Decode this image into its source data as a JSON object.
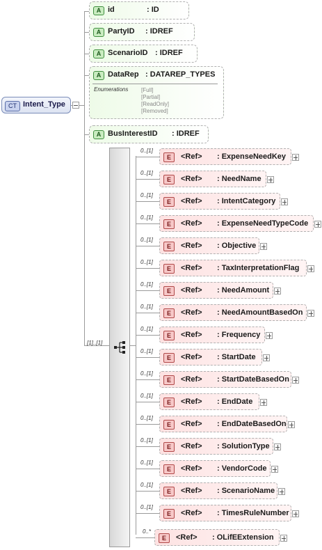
{
  "complex_type": {
    "badge": "CT",
    "name": "Intent_Type"
  },
  "attributes": [
    {
      "badge": "A",
      "name": "id",
      "type": ": ID"
    },
    {
      "badge": "A",
      "name": "PartyID",
      "type": ": IDREF"
    },
    {
      "badge": "A",
      "name": "ScenarioID",
      "type": ": IDREF"
    },
    {
      "badge": "A",
      "name": "DataRep",
      "type": ": DATAREP_TYPES",
      "enumerations_title": "Enumerations",
      "enumerations": [
        "[Full]",
        "[Partial]",
        "[ReadOnly]",
        "[Removed]"
      ]
    },
    {
      "badge": "A",
      "name": "BusInterestID",
      "type": ": IDREF"
    }
  ],
  "sequence": {
    "cardinality": "[1]..[1]"
  },
  "elements": [
    {
      "badge": "E",
      "ref": "<Ref>",
      "name": ": ExpenseNeedKey",
      "cardinality": "0..[1]"
    },
    {
      "badge": "E",
      "ref": "<Ref>",
      "name": ": NeedName",
      "cardinality": "0..[1]"
    },
    {
      "badge": "E",
      "ref": "<Ref>",
      "name": ": IntentCategory",
      "cardinality": "0..[1]"
    },
    {
      "badge": "E",
      "ref": "<Ref>",
      "name": ": ExpenseNeedTypeCode",
      "cardinality": "0..[1]"
    },
    {
      "badge": "E",
      "ref": "<Ref>",
      "name": ": Objective",
      "cardinality": "0..[1]"
    },
    {
      "badge": "E",
      "ref": "<Ref>",
      "name": ": TaxInterpretationFlag",
      "cardinality": "0..[1]"
    },
    {
      "badge": "E",
      "ref": "<Ref>",
      "name": ": NeedAmount",
      "cardinality": "0..[1]"
    },
    {
      "badge": "E",
      "ref": "<Ref>",
      "name": ": NeedAmountBasedOn",
      "cardinality": "0..[1]"
    },
    {
      "badge": "E",
      "ref": "<Ref>",
      "name": ": Frequency",
      "cardinality": "0..[1]"
    },
    {
      "badge": "E",
      "ref": "<Ref>",
      "name": ": StartDate",
      "cardinality": "0..[1]"
    },
    {
      "badge": "E",
      "ref": "<Ref>",
      "name": ": StartDateBasedOn",
      "cardinality": "0..[1]"
    },
    {
      "badge": "E",
      "ref": "<Ref>",
      "name": ": EndDate",
      "cardinality": "0..[1]"
    },
    {
      "badge": "E",
      "ref": "<Ref>",
      "name": ": EndDateBasedOn",
      "cardinality": "0..[1]"
    },
    {
      "badge": "E",
      "ref": "<Ref>",
      "name": ": SolutionType",
      "cardinality": "0..[1]"
    },
    {
      "badge": "E",
      "ref": "<Ref>",
      "name": ": VendorCode",
      "cardinality": "0..[1]"
    },
    {
      "badge": "E",
      "ref": "<Ref>",
      "name": ": ScenarioName",
      "cardinality": "0..[1]"
    },
    {
      "badge": "E",
      "ref": "<Ref>",
      "name": ": TimesRuleNumber",
      "cardinality": "0..[1]"
    },
    {
      "badge": "E",
      "ref": "<Ref>",
      "name": ": OLifEExtension",
      "cardinality": "0..*"
    }
  ]
}
